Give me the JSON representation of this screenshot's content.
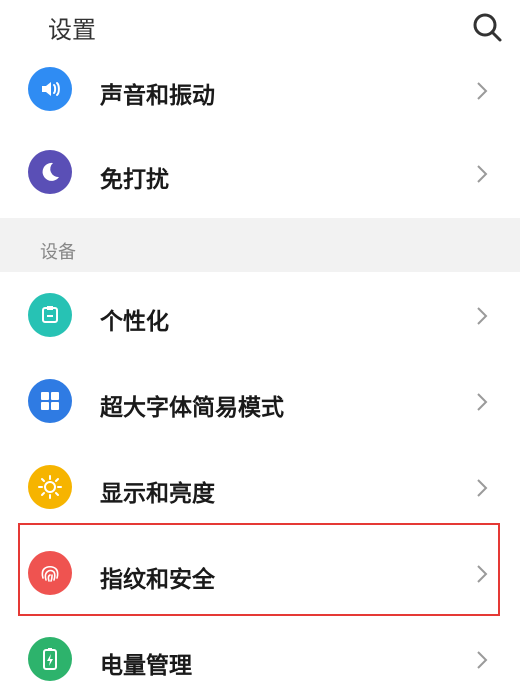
{
  "header": {
    "title": "设置",
    "search_icon": "search-icon"
  },
  "section": {
    "title": "设备"
  },
  "items_top": [
    {
      "label": "声音和振动",
      "icon": "speaker-icon",
      "color": "#2F8CF3"
    },
    {
      "label": "免打扰",
      "icon": "moon-icon",
      "color": "#5A4FB6"
    }
  ],
  "items_device": [
    {
      "label": "个性化",
      "icon": "personalize-icon",
      "color": "#27C2B4"
    },
    {
      "label": "超大字体简易模式",
      "icon": "grid-icon",
      "color": "#2F7BE3"
    },
    {
      "label": "显示和亮度",
      "icon": "sun-icon",
      "color": "#F6B400"
    },
    {
      "label": "指纹和安全",
      "icon": "fingerprint-icon",
      "color": "#EF5350"
    },
    {
      "label": "电量管理",
      "icon": "battery-icon",
      "color": "#2DB36C"
    }
  ],
  "highlight_color": "#E53935"
}
